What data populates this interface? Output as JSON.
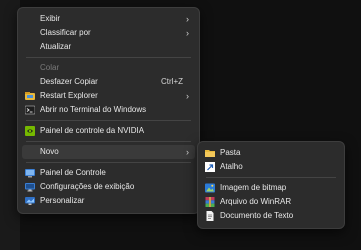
{
  "main_menu": {
    "view": "Exibir",
    "sort_by": "Classificar por",
    "refresh": "Atualizar",
    "paste": "Colar",
    "undo_copy": "Desfazer Copiar",
    "undo_shortcut": "Ctrl+Z",
    "restart_explorer": "Restart Explorer",
    "open_terminal": "Abrir no Terminal do Windows",
    "nvidia_panel": "Painel de controle da NVIDIA",
    "new": "Novo",
    "control_panel": "Painel de Controle",
    "display_settings": "Configurações de exibição",
    "personalize": "Personalizar"
  },
  "sub_menu": {
    "folder": "Pasta",
    "shortcut": "Atalho",
    "bitmap": "Imagem de bitmap",
    "winrar": "Arquivo do WinRAR",
    "text_doc": "Documento de Texto"
  },
  "icons": {
    "restart": "restart-explorer-icon",
    "terminal": "terminal-icon",
    "nvidia": "nvidia-icon",
    "control_panel": "control-panel-icon",
    "display": "display-icon",
    "personalize": "personalize-icon",
    "folder": "folder-icon",
    "shortcut": "shortcut-icon",
    "bitmap": "bitmap-icon",
    "winrar": "winrar-icon",
    "text": "text-document-icon"
  },
  "colors": {
    "menu_bg": "#2c2c2c",
    "highlight": "#3a3a3a",
    "folder": "#e8b93c",
    "nvidia": "#76b900"
  }
}
